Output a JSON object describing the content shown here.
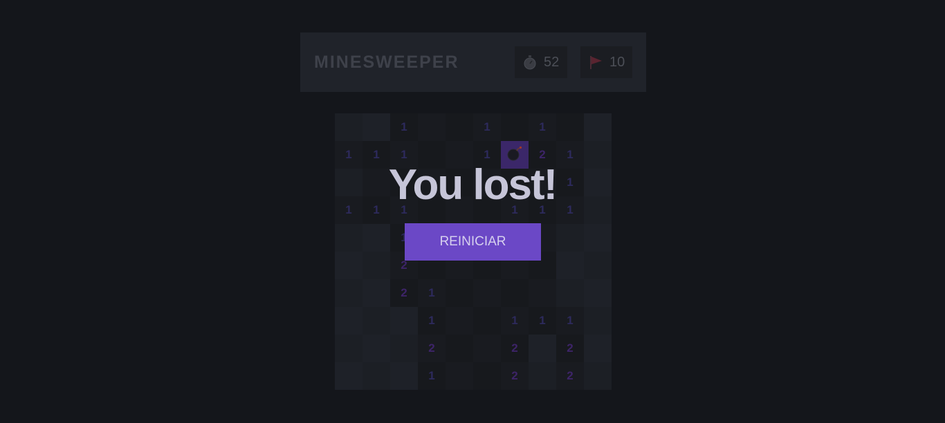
{
  "header": {
    "title": "MINESWEEPER",
    "timer": {
      "icon": "stopwatch-icon",
      "value": "52"
    },
    "flags": {
      "icon": "flag-icon",
      "value": "10"
    }
  },
  "board": {
    "rows": [
      [
        "",
        "",
        "1",
        "",
        "",
        "1",
        "",
        "1",
        "",
        ""
      ],
      [
        "1",
        "1",
        "1",
        "",
        "",
        "1",
        "*",
        "2",
        "1",
        ""
      ],
      [
        "",
        "",
        "",
        "",
        "",
        "",
        "",
        "",
        "1",
        ""
      ],
      [
        "1",
        "1",
        "1",
        "",
        "",
        "",
        "1",
        "1",
        "1",
        ""
      ],
      [
        "",
        "",
        "1",
        "",
        "",
        "",
        "",
        "",
        "",
        ""
      ],
      [
        "",
        "",
        "2",
        "",
        "",
        "",
        "",
        "",
        "",
        ""
      ],
      [
        "",
        "",
        "2",
        "1",
        "",
        "",
        "",
        "",
        "",
        ""
      ],
      [
        "",
        "",
        "",
        "1",
        "",
        "",
        "1",
        "1",
        "1",
        ""
      ],
      [
        "",
        "",
        "",
        "2",
        "",
        "",
        "2",
        "",
        "2",
        ""
      ],
      [
        "",
        "",
        "",
        "1",
        "",
        "",
        "2",
        "",
        "2",
        ""
      ]
    ],
    "revealed": [
      [
        0,
        0,
        1,
        1,
        1,
        1,
        1,
        1,
        1,
        0
      ],
      [
        1,
        1,
        1,
        1,
        1,
        1,
        1,
        1,
        1,
        0
      ],
      [
        0,
        1,
        1,
        1,
        1,
        1,
        1,
        1,
        1,
        0
      ],
      [
        1,
        1,
        1,
        1,
        1,
        1,
        1,
        1,
        1,
        0
      ],
      [
        0,
        0,
        1,
        1,
        1,
        1,
        1,
        1,
        0,
        0
      ],
      [
        0,
        0,
        1,
        1,
        1,
        1,
        1,
        1,
        0,
        0
      ],
      [
        0,
        0,
        1,
        1,
        1,
        1,
        1,
        1,
        0,
        0
      ],
      [
        0,
        0,
        0,
        1,
        1,
        1,
        1,
        1,
        1,
        0
      ],
      [
        0,
        0,
        0,
        1,
        1,
        1,
        1,
        0,
        1,
        0
      ],
      [
        0,
        0,
        0,
        1,
        1,
        1,
        1,
        0,
        1,
        0
      ]
    ],
    "mine_icon": "bomb-icon",
    "colors": {
      "one": "#2d2a5c",
      "two": "#3d2468",
      "mine_bg": "#3b2769",
      "accent": "#6b48c6"
    }
  },
  "overlay": {
    "message": "You lost!",
    "button_label": "REINICIAR"
  }
}
